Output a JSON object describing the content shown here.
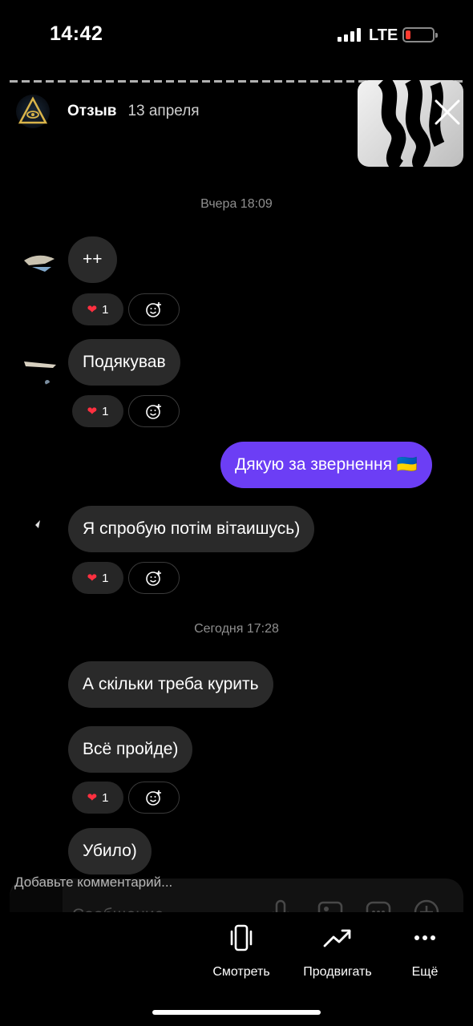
{
  "status_bar": {
    "time": "14:42",
    "network": "LTE"
  },
  "story": {
    "title": "Отзыв",
    "date": "13 апреля",
    "comment_placeholder": "Добавьте комментарий..."
  },
  "chat": {
    "timestamps": [
      "Вчера 18:09",
      "Сегодня 17:28"
    ],
    "messages": [
      {
        "text": "++",
        "direction": "in"
      },
      {
        "text": "Подякував",
        "direction": "in"
      },
      {
        "text": "Дякую за звернення 🇺🇦",
        "direction": "out"
      },
      {
        "text": "Я спробую потім вітаишусь)",
        "direction": "in"
      },
      {
        "text": "А скільки треба курить",
        "direction": "in"
      },
      {
        "text": "Всё пройде)",
        "direction": "in"
      },
      {
        "text": "Убило)",
        "direction": "in"
      }
    ],
    "reaction_count": "1",
    "composer_placeholder": "Сообщение"
  },
  "bottom_bar": {
    "actions": [
      {
        "label": "Смотреть",
        "icon": "phone-rotate-icon"
      },
      {
        "label": "Продвигать",
        "icon": "trending-up-icon"
      },
      {
        "label": "Ещё",
        "icon": "more-dots-icon"
      }
    ]
  },
  "colors": {
    "outgoing_bubble": "#6c3ef5",
    "incoming_bubble": "#2a2a2a",
    "battery_low": "#ff3b30"
  }
}
